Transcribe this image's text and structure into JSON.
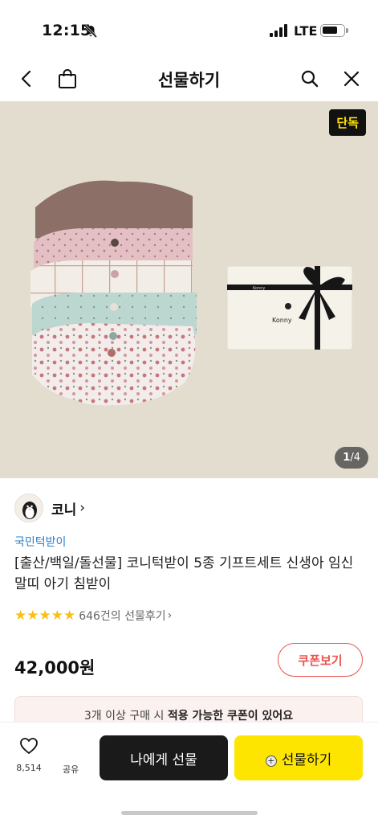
{
  "status_bar": {
    "time": "12:15",
    "network": "LTE"
  },
  "header": {
    "title": "선물하기"
  },
  "hero": {
    "badge": "단독",
    "page_current": "1",
    "page_total": "/4",
    "brand_mark": "Konny"
  },
  "seller": {
    "name": "코니",
    "chevron": "›"
  },
  "product": {
    "category": "국민턱받이",
    "title": "[출산/백일/돌선물] 코니턱받이 5종 기프트세트 신생아 임신 말띠 아기 침받이",
    "stars": "★★★★★",
    "review_count": "646건의 선물후기",
    "review_chevron": "›",
    "price": "42,000원",
    "coupon_button": "쿠폰보기"
  },
  "coupon_notice": {
    "prefix": "3개 이상 구매 시 ",
    "highlight": "적용 가능한 쿠폰이 있어요"
  },
  "bottom_bar": {
    "like_count": "8,514",
    "share_label": "공유",
    "gift_me_label": "나에게 선물",
    "gift_label": "선물하기"
  },
  "colors": {
    "accent_yellow": "#fee500",
    "coupon_red": "#e8554e",
    "link_blue": "#2a7fc9"
  }
}
